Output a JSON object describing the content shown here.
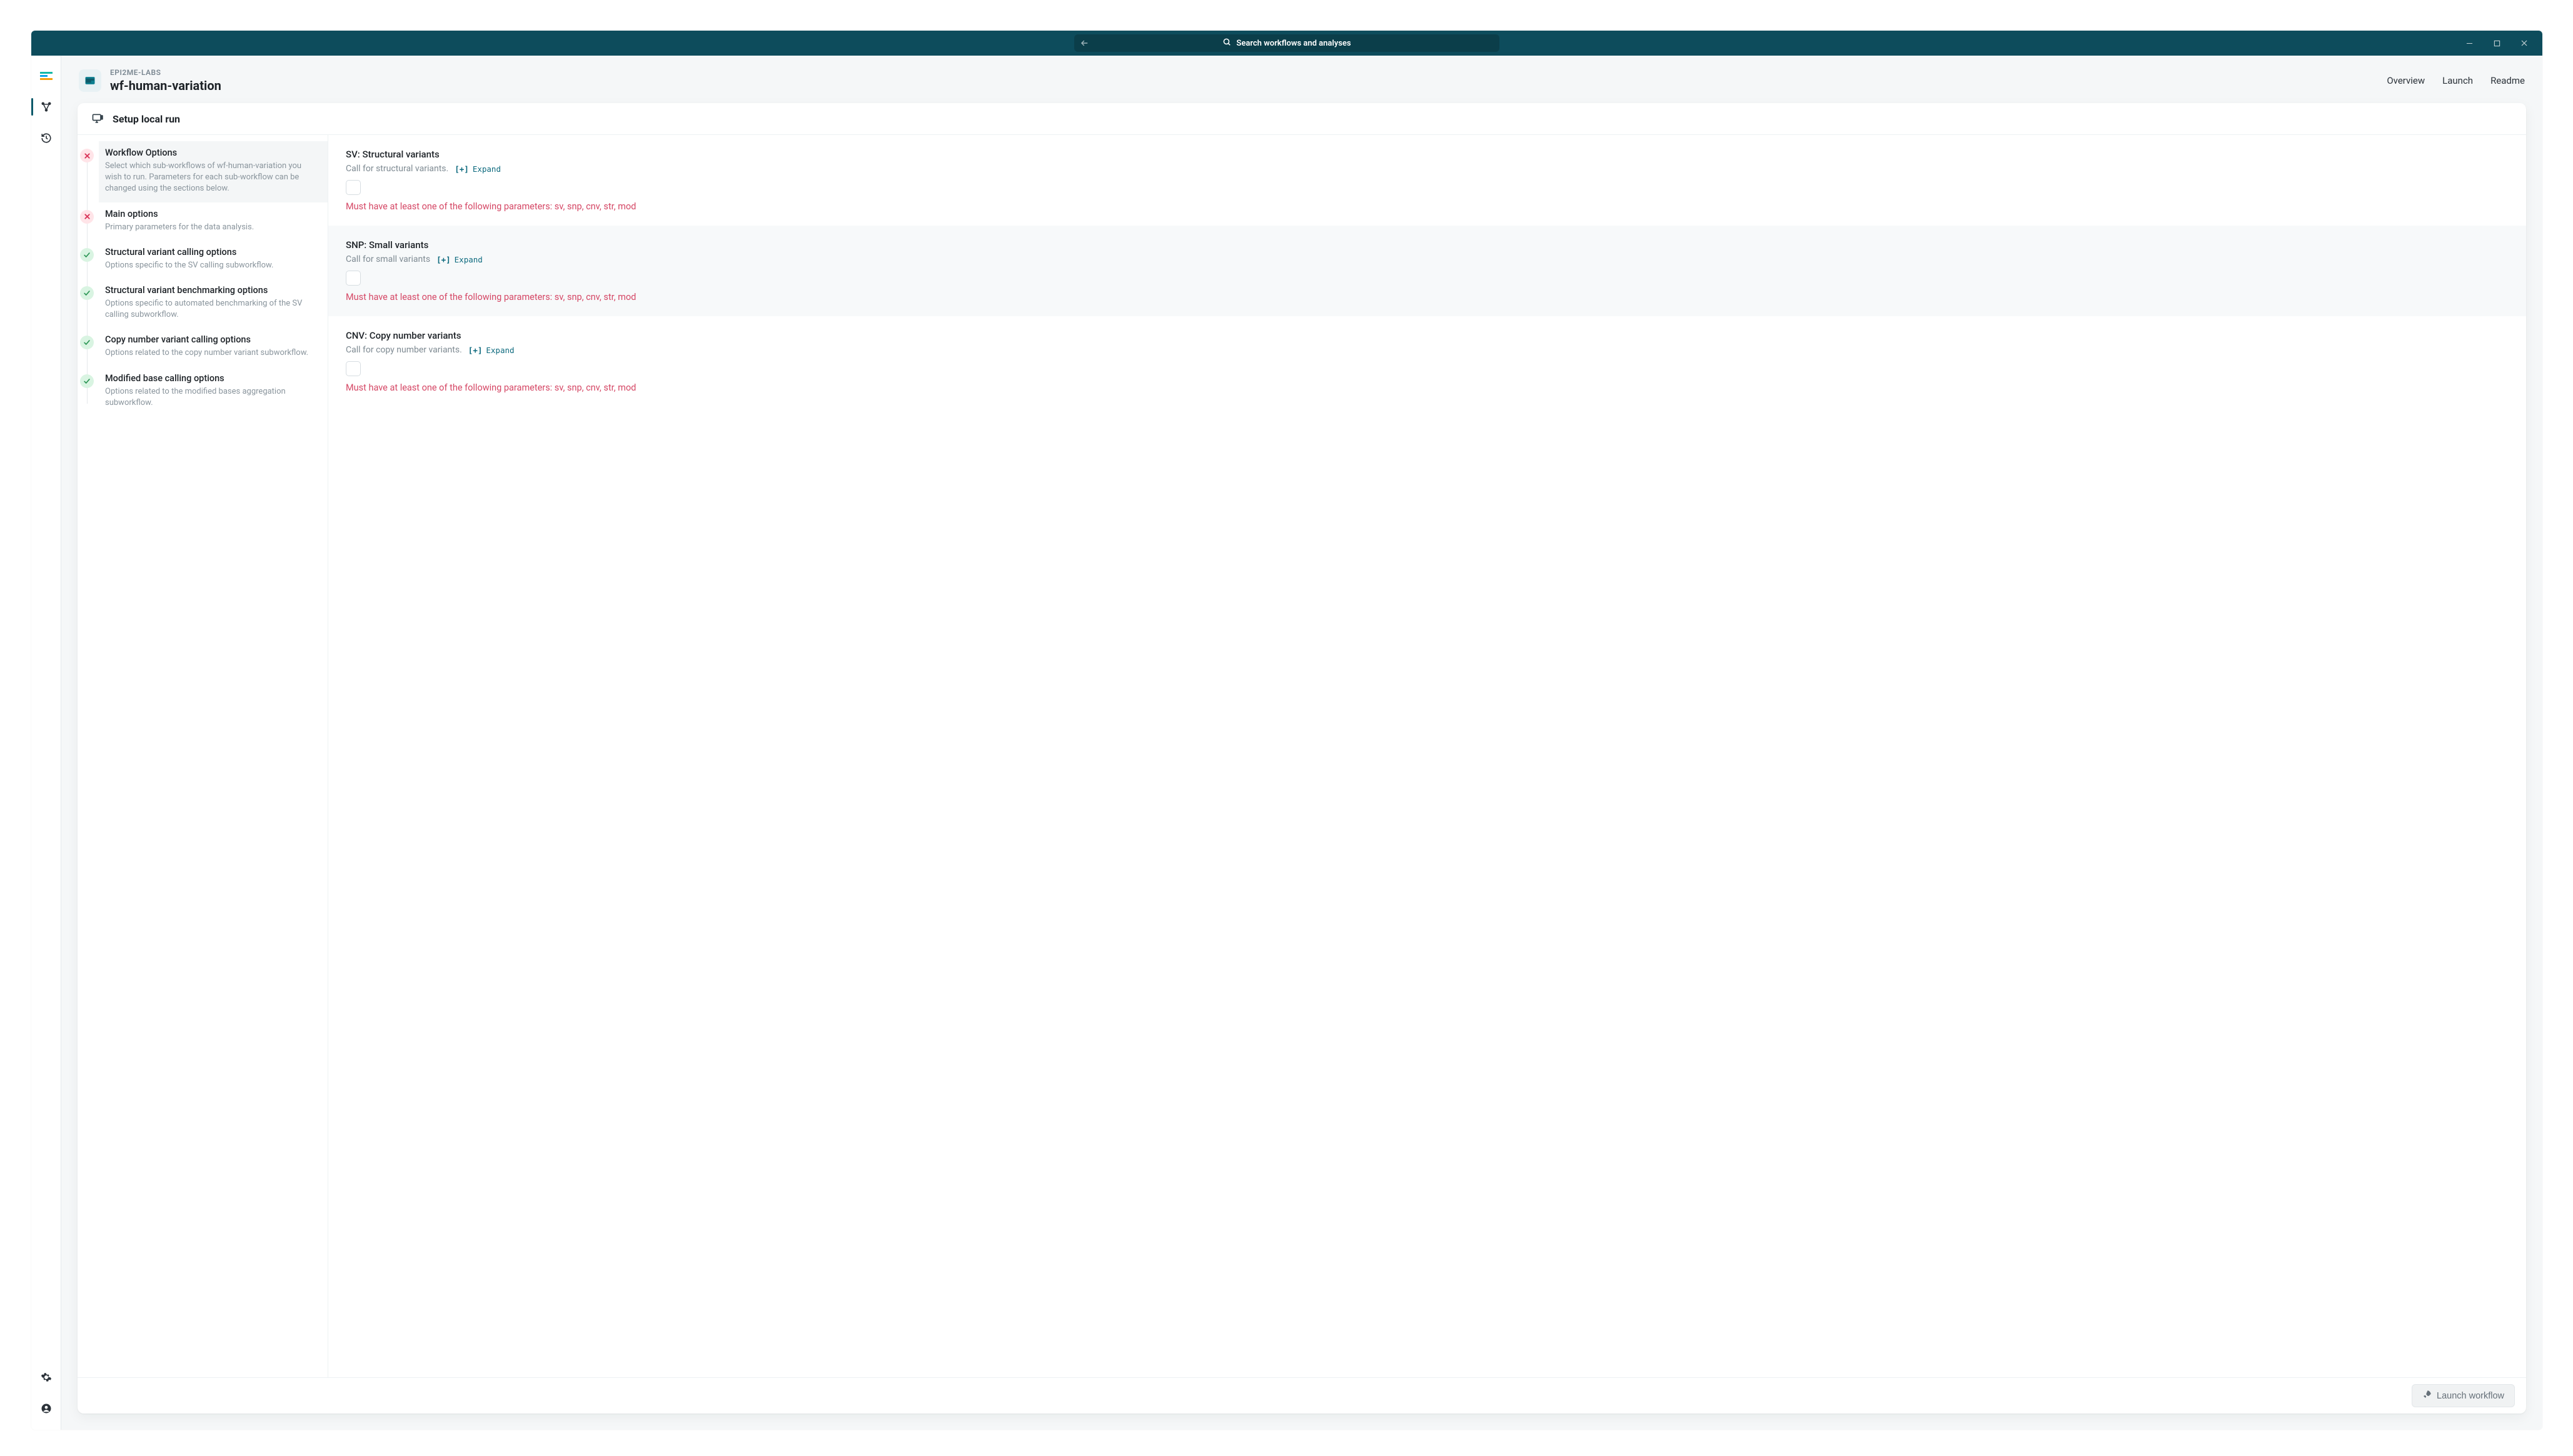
{
  "titlebar": {
    "search_placeholder": "Search workflows and analyses"
  },
  "breadcrumb": {
    "org": "EPI2ME-LABS",
    "workflow": "wf-human-variation"
  },
  "tabs": {
    "overview": "Overview",
    "launch": "Launch",
    "readme": "Readme"
  },
  "card": {
    "title": "Setup local run",
    "launch_button": "Launch workflow"
  },
  "steps": [
    {
      "status": "err",
      "title": "Workflow Options",
      "desc": "Select which sub-workflows of wf-human-variation you wish to run. Parameters for each sub-workflow can be changed using the sections below."
    },
    {
      "status": "err",
      "title": "Main options",
      "desc": "Primary parameters for the data analysis."
    },
    {
      "status": "ok",
      "title": "Structural variant calling options",
      "desc": "Options specific to the SV calling subworkflow."
    },
    {
      "status": "ok",
      "title": "Structural variant benchmarking options",
      "desc": "Options specific to automated benchmarking of the SV calling subworkflow."
    },
    {
      "status": "ok",
      "title": "Copy number variant calling options",
      "desc": "Options related to the copy number variant subworkflow."
    },
    {
      "status": "ok",
      "title": "Modified base calling options",
      "desc": "Options related to the modified bases aggregation subworkflow."
    }
  ],
  "expand_bracket": "[+]",
  "expand_label": "Expand",
  "error_message": "Must have at least one of the following parameters: sv, snp, cnv, str, mod",
  "params": [
    {
      "title": "SV: Structural variants",
      "desc": "Call for structural variants."
    },
    {
      "title": "SNP: Small variants",
      "desc": "Call for small variants"
    },
    {
      "title": "CNV: Copy number variants",
      "desc": "Call for copy number variants."
    }
  ]
}
